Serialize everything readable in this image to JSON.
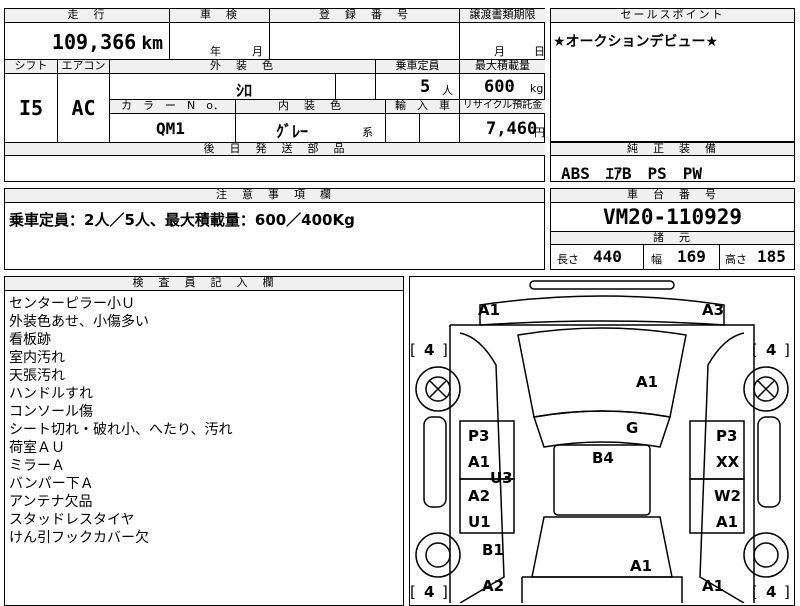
{
  "top": {
    "mileage_label": "走　行",
    "mileage_value": "109,366",
    "mileage_unit": "km",
    "inspection_label": "車　検",
    "inspection_year": "年",
    "inspection_month": "月",
    "registration_label": "登　録　番　号",
    "transfer_label": "譲渡書類期限",
    "transfer_month": "月",
    "transfer_day": "日",
    "selling_points_label": "セールスポイント",
    "selling_points_text": "★オークションデビュー★"
  },
  "spec": {
    "shift_label": "シフト",
    "shift_value": "I5",
    "ac_label": "エアコン",
    "ac_value": "AC",
    "exterior_label": "外　装　色",
    "exterior_value": "ｼﾛ",
    "capacity_label": "乗車定員",
    "capacity_value": "5",
    "capacity_unit": "人",
    "load_label": "最大積載量",
    "load_value": "600",
    "load_unit": "kg",
    "color_no_label": "カ　ラ　ー　N　o．",
    "color_no_value": "QM1",
    "interior_label": "内　装　色",
    "interior_value": "ｸﾞﾚｰ",
    "interior_suffix": "系",
    "import_label": "輸　入　車",
    "recycle_label": "リサイクル預託金",
    "recycle_value": "7,460",
    "recycle_unit": "円",
    "delivery_label": "後　日　発　送　部　品"
  },
  "equipment": {
    "label": "純　正　装　備",
    "value": "ABS　ｴｱB　PS　PW"
  },
  "notes": {
    "label": "注　意　事　項　欄",
    "value": "乗車定員：2人／5人、最大積載量：600／400Kg"
  },
  "chassis": {
    "label": "車　台　番　号",
    "value": "VM20-110929",
    "dims_label": "諸　元",
    "length_label": "長さ",
    "length_value": "440",
    "width_label": "幅",
    "width_value": "169",
    "height_label": "高さ",
    "height_value": "185"
  },
  "inspector": {
    "label": "検　査　員　記　入　欄",
    "lines": [
      "センターピラー小Ｕ",
      "外装色あせ、小傷多い",
      "看板跡",
      "室内汚れ",
      "天張汚れ",
      "ハンドルすれ",
      "コンソール傷",
      "シート切れ・破れ小、へたり、汚れ",
      "荷室ＡＵ",
      "ミラーＡ",
      "バンパー下Ａ",
      "アンテナ欠品",
      "スタッドレスタイヤ",
      "けん引フックカバー欠"
    ]
  },
  "diagram": {
    "marks": {
      "a1_front_left": "A1",
      "a3_front_right": "A3",
      "tire_fl": "4",
      "tire_fr": "4",
      "tire_rl": "4",
      "tire_rr": "4",
      "bracket_open": "[",
      "bracket_close": "]",
      "hood": "A1",
      "windshield": "G",
      "roof": "B4",
      "left_door1_top": "P3",
      "left_door1_bottom": "A1",
      "left_u3": "U3",
      "left_door2_top": "A2",
      "left_door2_bottom": "U1",
      "left_rear": "B1",
      "right_door1_top": "P3",
      "right_door1_bottom": "XX",
      "right_door2_top": "W2",
      "right_door2_bottom": "A1",
      "rear_center": "A1",
      "rear_left": "A2",
      "rear_right": "A1"
    }
  }
}
